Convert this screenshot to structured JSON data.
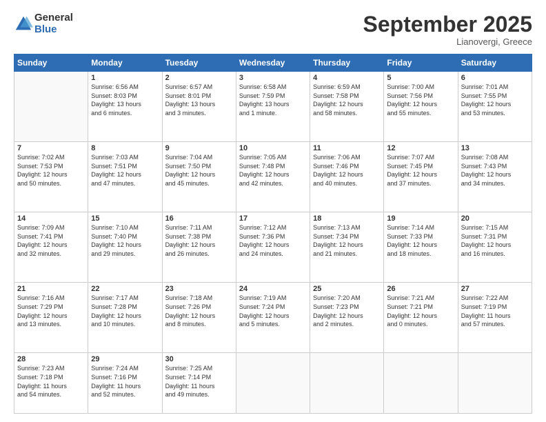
{
  "logo": {
    "general": "General",
    "blue": "Blue"
  },
  "header": {
    "month": "September 2025",
    "location": "Lianovergi, Greece"
  },
  "weekdays": [
    "Sunday",
    "Monday",
    "Tuesday",
    "Wednesday",
    "Thursday",
    "Friday",
    "Saturday"
  ],
  "weeks": [
    [
      {
        "day": "",
        "info": ""
      },
      {
        "day": "1",
        "info": "Sunrise: 6:56 AM\nSunset: 8:03 PM\nDaylight: 13 hours\nand 6 minutes."
      },
      {
        "day": "2",
        "info": "Sunrise: 6:57 AM\nSunset: 8:01 PM\nDaylight: 13 hours\nand 3 minutes."
      },
      {
        "day": "3",
        "info": "Sunrise: 6:58 AM\nSunset: 7:59 PM\nDaylight: 13 hours\nand 1 minute."
      },
      {
        "day": "4",
        "info": "Sunrise: 6:59 AM\nSunset: 7:58 PM\nDaylight: 12 hours\nand 58 minutes."
      },
      {
        "day": "5",
        "info": "Sunrise: 7:00 AM\nSunset: 7:56 PM\nDaylight: 12 hours\nand 55 minutes."
      },
      {
        "day": "6",
        "info": "Sunrise: 7:01 AM\nSunset: 7:55 PM\nDaylight: 12 hours\nand 53 minutes."
      }
    ],
    [
      {
        "day": "7",
        "info": "Sunrise: 7:02 AM\nSunset: 7:53 PM\nDaylight: 12 hours\nand 50 minutes."
      },
      {
        "day": "8",
        "info": "Sunrise: 7:03 AM\nSunset: 7:51 PM\nDaylight: 12 hours\nand 47 minutes."
      },
      {
        "day": "9",
        "info": "Sunrise: 7:04 AM\nSunset: 7:50 PM\nDaylight: 12 hours\nand 45 minutes."
      },
      {
        "day": "10",
        "info": "Sunrise: 7:05 AM\nSunset: 7:48 PM\nDaylight: 12 hours\nand 42 minutes."
      },
      {
        "day": "11",
        "info": "Sunrise: 7:06 AM\nSunset: 7:46 PM\nDaylight: 12 hours\nand 40 minutes."
      },
      {
        "day": "12",
        "info": "Sunrise: 7:07 AM\nSunset: 7:45 PM\nDaylight: 12 hours\nand 37 minutes."
      },
      {
        "day": "13",
        "info": "Sunrise: 7:08 AM\nSunset: 7:43 PM\nDaylight: 12 hours\nand 34 minutes."
      }
    ],
    [
      {
        "day": "14",
        "info": "Sunrise: 7:09 AM\nSunset: 7:41 PM\nDaylight: 12 hours\nand 32 minutes."
      },
      {
        "day": "15",
        "info": "Sunrise: 7:10 AM\nSunset: 7:40 PM\nDaylight: 12 hours\nand 29 minutes."
      },
      {
        "day": "16",
        "info": "Sunrise: 7:11 AM\nSunset: 7:38 PM\nDaylight: 12 hours\nand 26 minutes."
      },
      {
        "day": "17",
        "info": "Sunrise: 7:12 AM\nSunset: 7:36 PM\nDaylight: 12 hours\nand 24 minutes."
      },
      {
        "day": "18",
        "info": "Sunrise: 7:13 AM\nSunset: 7:34 PM\nDaylight: 12 hours\nand 21 minutes."
      },
      {
        "day": "19",
        "info": "Sunrise: 7:14 AM\nSunset: 7:33 PM\nDaylight: 12 hours\nand 18 minutes."
      },
      {
        "day": "20",
        "info": "Sunrise: 7:15 AM\nSunset: 7:31 PM\nDaylight: 12 hours\nand 16 minutes."
      }
    ],
    [
      {
        "day": "21",
        "info": "Sunrise: 7:16 AM\nSunset: 7:29 PM\nDaylight: 12 hours\nand 13 minutes."
      },
      {
        "day": "22",
        "info": "Sunrise: 7:17 AM\nSunset: 7:28 PM\nDaylight: 12 hours\nand 10 minutes."
      },
      {
        "day": "23",
        "info": "Sunrise: 7:18 AM\nSunset: 7:26 PM\nDaylight: 12 hours\nand 8 minutes."
      },
      {
        "day": "24",
        "info": "Sunrise: 7:19 AM\nSunset: 7:24 PM\nDaylight: 12 hours\nand 5 minutes."
      },
      {
        "day": "25",
        "info": "Sunrise: 7:20 AM\nSunset: 7:23 PM\nDaylight: 12 hours\nand 2 minutes."
      },
      {
        "day": "26",
        "info": "Sunrise: 7:21 AM\nSunset: 7:21 PM\nDaylight: 12 hours\nand 0 minutes."
      },
      {
        "day": "27",
        "info": "Sunrise: 7:22 AM\nSunset: 7:19 PM\nDaylight: 11 hours\nand 57 minutes."
      }
    ],
    [
      {
        "day": "28",
        "info": "Sunrise: 7:23 AM\nSunset: 7:18 PM\nDaylight: 11 hours\nand 54 minutes."
      },
      {
        "day": "29",
        "info": "Sunrise: 7:24 AM\nSunset: 7:16 PM\nDaylight: 11 hours\nand 52 minutes."
      },
      {
        "day": "30",
        "info": "Sunrise: 7:25 AM\nSunset: 7:14 PM\nDaylight: 11 hours\nand 49 minutes."
      },
      {
        "day": "",
        "info": ""
      },
      {
        "day": "",
        "info": ""
      },
      {
        "day": "",
        "info": ""
      },
      {
        "day": "",
        "info": ""
      }
    ]
  ]
}
